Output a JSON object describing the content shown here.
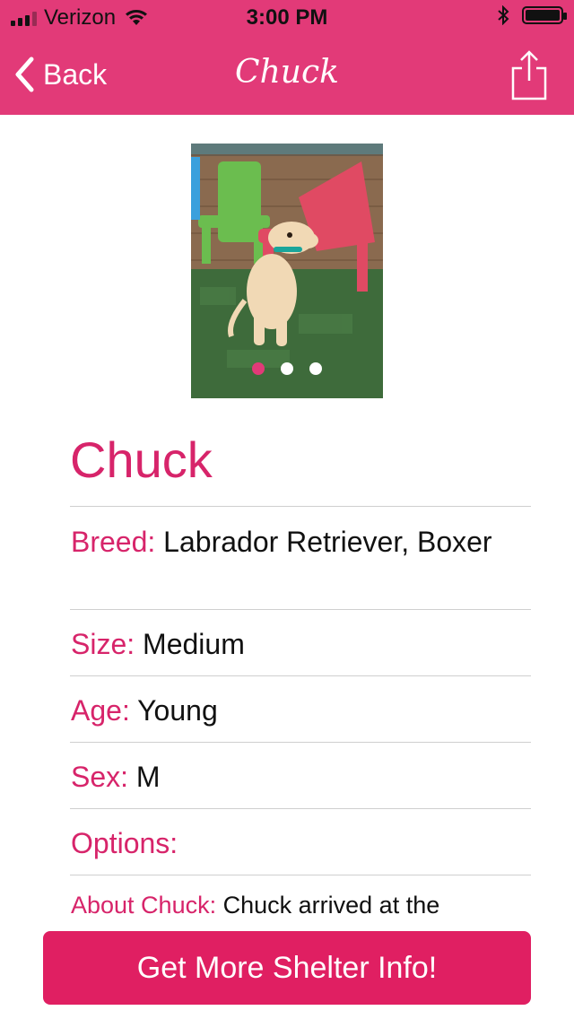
{
  "status_bar": {
    "carrier": "Verizon",
    "time": "3:00 PM"
  },
  "nav": {
    "back_label": "Back",
    "title": "Chuck",
    "share_icon": "share-icon"
  },
  "carousel": {
    "photo_alt": "dog photo",
    "page_count": 3,
    "active_index": 0
  },
  "pet": {
    "name": "Chuck",
    "breed_label": "Breed:",
    "breed_value": "Labrador Retriever, Boxer",
    "size_label": "Size:",
    "size_value": "Medium",
    "age_label": "Age:",
    "age_value": "Young",
    "sex_label": "Sex:",
    "sex_value": "M",
    "options_label": "Options:",
    "about_label": "About Chuck:",
    "about_value": "Chuck arrived at the"
  },
  "cta": {
    "label": "Get More Shelter Info!"
  },
  "colors": {
    "accent": "#E23A78",
    "accent_text": "#D7246A",
    "cta_bg": "#E01F62"
  }
}
